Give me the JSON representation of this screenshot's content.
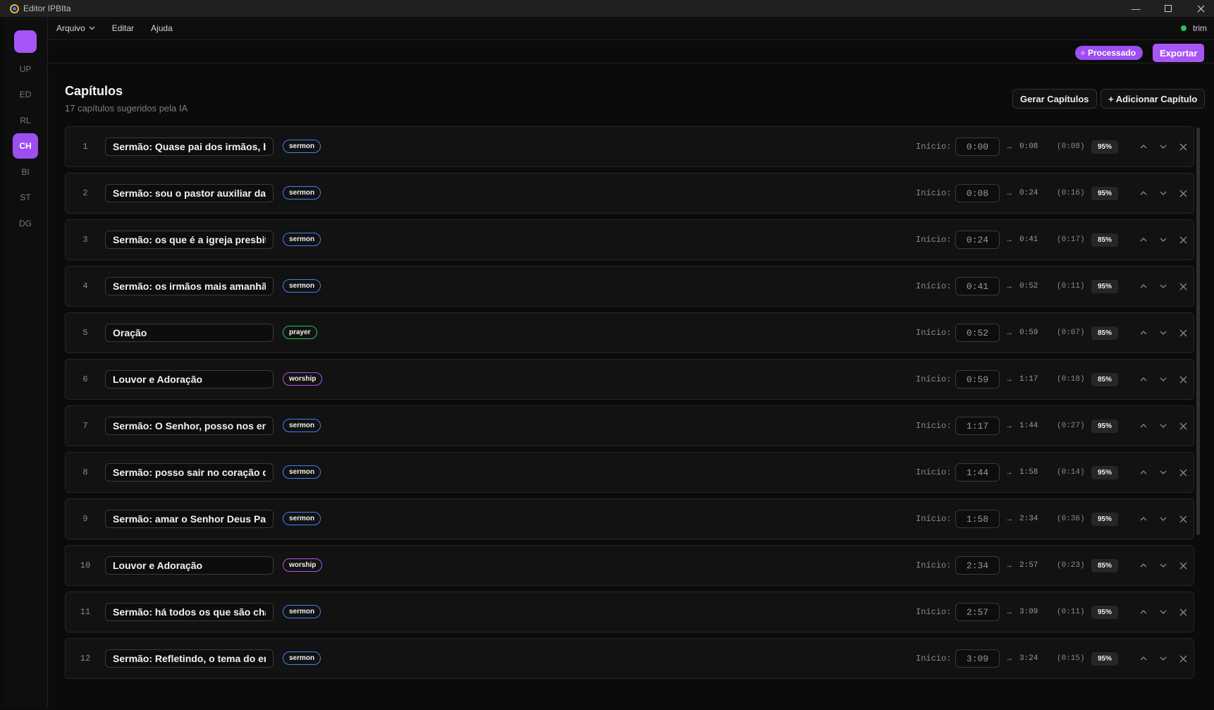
{
  "window": {
    "title": "Editor IPBIta"
  },
  "rail": {
    "items": [
      "UP",
      "ED",
      "RL",
      "CH",
      "BI",
      "ST",
      "DG"
    ],
    "active": "CH"
  },
  "menubar": {
    "file": "Arquivo",
    "edit": "Editar",
    "help": "Ajuda",
    "trim_label": "trim"
  },
  "toolbar": {
    "status": "Processado",
    "export": "Exportar"
  },
  "colors": {
    "accent": "#a855f7",
    "sermon": "#3b82f6",
    "prayer": "#22c55e",
    "worship": "#a855f7",
    "ok": "#22c55e"
  },
  "chapters": {
    "title": "Capítulos",
    "subtitle": "17 capítulos sugeridos pela IA",
    "generate_label": "Gerar Capítulos",
    "add_label": "+ Adicionar Capítulo",
    "start_label": "Início:",
    "arrow": "→",
    "items": [
      {
        "num": "1",
        "title": "Sermão: Quase pai dos irmãos, bo",
        "type": "sermon",
        "start": "0:00",
        "end": "0:08",
        "duration": "(0:08)",
        "confidence": "95%"
      },
      {
        "num": "2",
        "title": "Sermão: sou o pastor auxiliar da i",
        "type": "sermon",
        "start": "0:08",
        "end": "0:24",
        "duration": "(0:16)",
        "confidence": "95%"
      },
      {
        "num": "3",
        "title": "Sermão: os que é a igreja presbite",
        "type": "sermon",
        "start": "0:24",
        "end": "0:41",
        "duration": "(0:17)",
        "confidence": "85%"
      },
      {
        "num": "4",
        "title": "Sermão: os irmãos mais amanhã e",
        "type": "sermon",
        "start": "0:41",
        "end": "0:52",
        "duration": "(0:11)",
        "confidence": "95%"
      },
      {
        "num": "5",
        "title": "Oração",
        "type": "prayer",
        "start": "0:52",
        "end": "0:59",
        "duration": "(0:07)",
        "confidence": "85%"
      },
      {
        "num": "6",
        "title": "Louvor e Adoração",
        "type": "worship",
        "start": "0:59",
        "end": "1:17",
        "duration": "(0:18)",
        "confidence": "85%"
      },
      {
        "num": "7",
        "title": "Sermão: O Senhor, posso nos enc",
        "type": "sermon",
        "start": "1:17",
        "end": "1:44",
        "duration": "(0:27)",
        "confidence": "95%"
      },
      {
        "num": "8",
        "title": "Sermão: posso sair no coração de",
        "type": "sermon",
        "start": "1:44",
        "end": "1:58",
        "duration": "(0:14)",
        "confidence": "95%"
      },
      {
        "num": "9",
        "title": "Sermão: amar o Senhor Deus Pai.",
        "type": "sermon",
        "start": "1:58",
        "end": "2:34",
        "duration": "(0:36)",
        "confidence": "95%"
      },
      {
        "num": "10",
        "title": "Louvor e Adoração",
        "type": "worship",
        "start": "2:34",
        "end": "2:57",
        "duration": "(0:23)",
        "confidence": "85%"
      },
      {
        "num": "11",
        "title": "Sermão: há todos os que são cha",
        "type": "sermon",
        "start": "2:57",
        "end": "3:09",
        "duration": "(0:11)",
        "confidence": "95%"
      },
      {
        "num": "12",
        "title": "Sermão: Refletindo, o tema do em",
        "type": "sermon",
        "start": "3:09",
        "end": "3:24",
        "duration": "(0:15)",
        "confidence": "95%"
      }
    ]
  }
}
